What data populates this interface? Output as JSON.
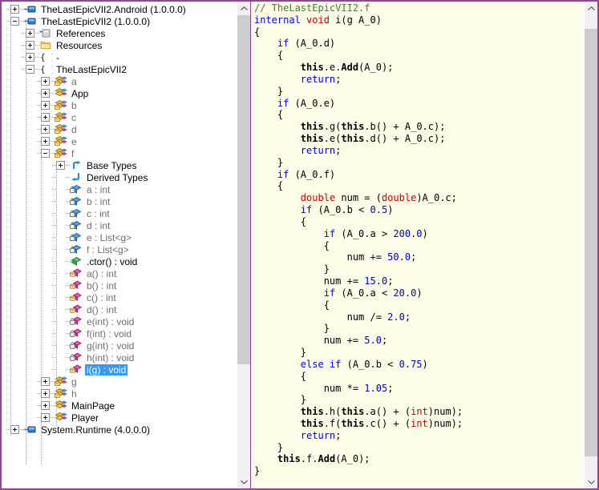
{
  "window": {
    "border_color": "#9b3f9b",
    "tree_bg": "#ffffff",
    "code_bg": "#fdfde8",
    "selection_color": "#3399ff"
  },
  "tree": {
    "name": "assembly-explorer",
    "nodes": [
      {
        "label": "TheLastEpicVII2.Android (1.0.0.0)",
        "depth": 0,
        "expander": "plus",
        "icon": "assembly-icon",
        "style": "asm"
      },
      {
        "label": "TheLastEpicVII2 (1.0.0.0)",
        "depth": 0,
        "expander": "minus",
        "icon": "assembly-icon",
        "style": "asm"
      },
      {
        "label": "References",
        "depth": 1,
        "expander": "plus",
        "icon": "references-icon",
        "style": "blk"
      },
      {
        "label": "Resources",
        "depth": 1,
        "expander": "plus",
        "icon": "folder-icon",
        "style": "blk"
      },
      {
        "label": "-",
        "depth": 1,
        "expander": "plus",
        "icon": "namespace-icon",
        "style": "blk"
      },
      {
        "label": "TheLastEpicVII2",
        "depth": 1,
        "expander": "minus",
        "icon": "namespace-icon",
        "style": "blk"
      },
      {
        "label": "a",
        "depth": 2,
        "expander": "plus",
        "icon": "class-internal-icon",
        "style": "int"
      },
      {
        "label": "App",
        "depth": 2,
        "expander": "plus",
        "icon": "class-public-icon",
        "style": "pub"
      },
      {
        "label": "b",
        "depth": 2,
        "expander": "plus",
        "icon": "class-internal-icon",
        "style": "int"
      },
      {
        "label": "c",
        "depth": 2,
        "expander": "plus",
        "icon": "class-internal-icon",
        "style": "int"
      },
      {
        "label": "d",
        "depth": 2,
        "expander": "plus",
        "icon": "class-internal-icon",
        "style": "int"
      },
      {
        "label": "e",
        "depth": 2,
        "expander": "plus",
        "icon": "class-internal-icon",
        "style": "int"
      },
      {
        "label": "f",
        "depth": 2,
        "expander": "minus",
        "icon": "class-internal-icon",
        "style": "int"
      },
      {
        "label": "Base Types",
        "depth": 3,
        "expander": "plus",
        "icon": "base-types-icon",
        "style": "blk"
      },
      {
        "label": "Derived Types",
        "depth": 3,
        "expander": "none",
        "icon": "derived-types-icon",
        "style": "blk"
      },
      {
        "label": "a : int",
        "depth": 3,
        "expander": "none",
        "icon": "field-private-icon",
        "style": "priv"
      },
      {
        "label": "b : int",
        "depth": 3,
        "expander": "none",
        "icon": "field-private-icon",
        "style": "priv"
      },
      {
        "label": "c : int",
        "depth": 3,
        "expander": "none",
        "icon": "field-private-icon",
        "style": "priv"
      },
      {
        "label": "d : int",
        "depth": 3,
        "expander": "none",
        "icon": "field-private-icon",
        "style": "priv"
      },
      {
        "label": "e : List<g>",
        "depth": 3,
        "expander": "none",
        "icon": "field-private-icon",
        "style": "priv"
      },
      {
        "label": "f : List<g>",
        "depth": 3,
        "expander": "none",
        "icon": "field-private-icon",
        "style": "priv"
      },
      {
        "label": ".ctor() : void",
        "depth": 3,
        "expander": "none",
        "icon": "constructor-icon",
        "style": "blk"
      },
      {
        "label": "a() : int",
        "depth": 3,
        "expander": "none",
        "icon": "method-internal-icon",
        "style": "int"
      },
      {
        "label": "b() : int",
        "depth": 3,
        "expander": "none",
        "icon": "method-internal-icon",
        "style": "int"
      },
      {
        "label": "c() : int",
        "depth": 3,
        "expander": "none",
        "icon": "method-internal-icon",
        "style": "int"
      },
      {
        "label": "d() : int",
        "depth": 3,
        "expander": "none",
        "icon": "method-internal-icon",
        "style": "int"
      },
      {
        "label": "e(int) : void",
        "depth": 3,
        "expander": "none",
        "icon": "method-private-icon",
        "style": "int"
      },
      {
        "label": "f(int) : void",
        "depth": 3,
        "expander": "none",
        "icon": "method-private-icon",
        "style": "int"
      },
      {
        "label": "g(int) : void",
        "depth": 3,
        "expander": "none",
        "icon": "method-private-icon",
        "style": "int"
      },
      {
        "label": "h(int) : void",
        "depth": 3,
        "expander": "none",
        "icon": "method-private-icon",
        "style": "int"
      },
      {
        "label": "i(g) : void",
        "depth": 3,
        "expander": "none",
        "icon": "method-internal-icon",
        "style": "int",
        "selected": true
      },
      {
        "label": "g",
        "depth": 2,
        "expander": "plus",
        "icon": "class-internal-icon",
        "style": "int"
      },
      {
        "label": "h",
        "depth": 2,
        "expander": "plus",
        "icon": "class-internal-icon",
        "style": "int"
      },
      {
        "label": "MainPage",
        "depth": 2,
        "expander": "plus",
        "icon": "class-public-icon",
        "style": "pub"
      },
      {
        "label": "Player",
        "depth": 2,
        "expander": "plus",
        "icon": "class-public-icon",
        "style": "pub"
      },
      {
        "label": "System.Runtime (4.0.0.0)",
        "depth": 0,
        "expander": "plus",
        "icon": "assembly-icon",
        "style": "asm",
        "clipped": true
      }
    ],
    "scrollbar": {
      "up_arrow": "chevron-up-icon",
      "down_arrow": "chevron-down-icon",
      "thumb_top_pct": 0,
      "thumb_height_pct": 76
    }
  },
  "code": {
    "name": "decompiled-code",
    "language": "csharp",
    "header_comment": "// TheLastEpicVII2.f",
    "lines": [
      [
        [
          "cm",
          "// TheLastEpicVII2.f"
        ]
      ],
      [
        [
          "kw",
          "internal "
        ],
        [
          "kwr",
          "void "
        ],
        [
          "id",
          "i(g A_0)"
        ]
      ],
      [
        [
          "id",
          "{"
        ]
      ],
      [
        [
          "id",
          "    "
        ],
        [
          "kw",
          "if"
        ],
        [
          "id",
          " (A_0.d)"
        ]
      ],
      [
        [
          "id",
          "    {"
        ]
      ],
      [
        [
          "id",
          "        "
        ],
        [
          "bld",
          "this"
        ],
        [
          "id",
          ".e."
        ],
        [
          "bld",
          "Add"
        ],
        [
          "id",
          "(A_0);"
        ]
      ],
      [
        [
          "id",
          "        "
        ],
        [
          "kw",
          "return"
        ],
        [
          "id",
          ";"
        ]
      ],
      [
        [
          "id",
          "    }"
        ]
      ],
      [
        [
          "id",
          "    "
        ],
        [
          "kw",
          "if"
        ],
        [
          "id",
          " (A_0.e)"
        ]
      ],
      [
        [
          "id",
          "    {"
        ]
      ],
      [
        [
          "id",
          "        "
        ],
        [
          "bld",
          "this"
        ],
        [
          "id",
          ".g("
        ],
        [
          "bld",
          "this"
        ],
        [
          "id",
          ".b() + A_0.c);"
        ]
      ],
      [
        [
          "id",
          "        "
        ],
        [
          "bld",
          "this"
        ],
        [
          "id",
          ".e("
        ],
        [
          "bld",
          "this"
        ],
        [
          "id",
          ".d() + A_0.c);"
        ]
      ],
      [
        [
          "id",
          "        "
        ],
        [
          "kw",
          "return"
        ],
        [
          "id",
          ";"
        ]
      ],
      [
        [
          "id",
          "    }"
        ]
      ],
      [
        [
          "id",
          "    "
        ],
        [
          "kw",
          "if"
        ],
        [
          "id",
          " (A_0.f)"
        ]
      ],
      [
        [
          "id",
          "    {"
        ]
      ],
      [
        [
          "id",
          "        "
        ],
        [
          "kwr",
          "double"
        ],
        [
          "id",
          " num = ("
        ],
        [
          "kwr",
          "double"
        ],
        [
          "id",
          ")A_0.c;"
        ]
      ],
      [
        [
          "id",
          "        "
        ],
        [
          "kw",
          "if"
        ],
        [
          "id",
          " (A_0.b < "
        ],
        [
          "num",
          "0.5"
        ],
        [
          "id",
          ")"
        ]
      ],
      [
        [
          "id",
          "        {"
        ]
      ],
      [
        [
          "id",
          "            "
        ],
        [
          "kw",
          "if"
        ],
        [
          "id",
          " (A_0.a > "
        ],
        [
          "num",
          "200.0"
        ],
        [
          "id",
          ")"
        ]
      ],
      [
        [
          "id",
          "            {"
        ]
      ],
      [
        [
          "id",
          "                num += "
        ],
        [
          "num",
          "50.0"
        ],
        [
          "id",
          ";"
        ]
      ],
      [
        [
          "id",
          "            }"
        ]
      ],
      [
        [
          "id",
          "            num += "
        ],
        [
          "num",
          "15.0"
        ],
        [
          "id",
          ";"
        ]
      ],
      [
        [
          "id",
          "            "
        ],
        [
          "kw",
          "if"
        ],
        [
          "id",
          " (A_0.a < "
        ],
        [
          "num",
          "20.0"
        ],
        [
          "id",
          ")"
        ]
      ],
      [
        [
          "id",
          "            {"
        ]
      ],
      [
        [
          "id",
          "                num /= "
        ],
        [
          "num",
          "2.0"
        ],
        [
          "id",
          ";"
        ]
      ],
      [
        [
          "id",
          "            }"
        ]
      ],
      [
        [
          "id",
          "            num += "
        ],
        [
          "num",
          "5.0"
        ],
        [
          "id",
          ";"
        ]
      ],
      [
        [
          "id",
          "        }"
        ]
      ],
      [
        [
          "id",
          "        "
        ],
        [
          "kw",
          "else if"
        ],
        [
          "id",
          " (A_0.b < "
        ],
        [
          "num",
          "0.75"
        ],
        [
          "id",
          ")"
        ]
      ],
      [
        [
          "id",
          "        {"
        ]
      ],
      [
        [
          "id",
          "            num *= "
        ],
        [
          "num",
          "1.05"
        ],
        [
          "id",
          ";"
        ]
      ],
      [
        [
          "id",
          "        }"
        ]
      ],
      [
        [
          "id",
          "        "
        ],
        [
          "bld",
          "this"
        ],
        [
          "id",
          ".h("
        ],
        [
          "bld",
          "this"
        ],
        [
          "id",
          ".a() + ("
        ],
        [
          "kwr",
          "int"
        ],
        [
          "id",
          ")num);"
        ]
      ],
      [
        [
          "id",
          "        "
        ],
        [
          "bld",
          "this"
        ],
        [
          "id",
          ".f("
        ],
        [
          "bld",
          "this"
        ],
        [
          "id",
          ".c() + ("
        ],
        [
          "kwr",
          "int"
        ],
        [
          "id",
          ")num);"
        ]
      ],
      [
        [
          "id",
          "        "
        ],
        [
          "kw",
          "return"
        ],
        [
          "id",
          ";"
        ]
      ],
      [
        [
          "id",
          "    }"
        ]
      ],
      [
        [
          "id",
          "    "
        ],
        [
          "bld",
          "this"
        ],
        [
          "id",
          ".f."
        ],
        [
          "bld",
          "Add"
        ],
        [
          "id",
          "(A_0);"
        ]
      ],
      [
        [
          "id",
          "}"
        ]
      ]
    ],
    "scrollbar": {
      "up_arrow": "chevron-up-icon",
      "down_arrow": "chevron-down-icon",
      "thumb_top_pct": 3,
      "thumb_height_pct": 93
    }
  }
}
